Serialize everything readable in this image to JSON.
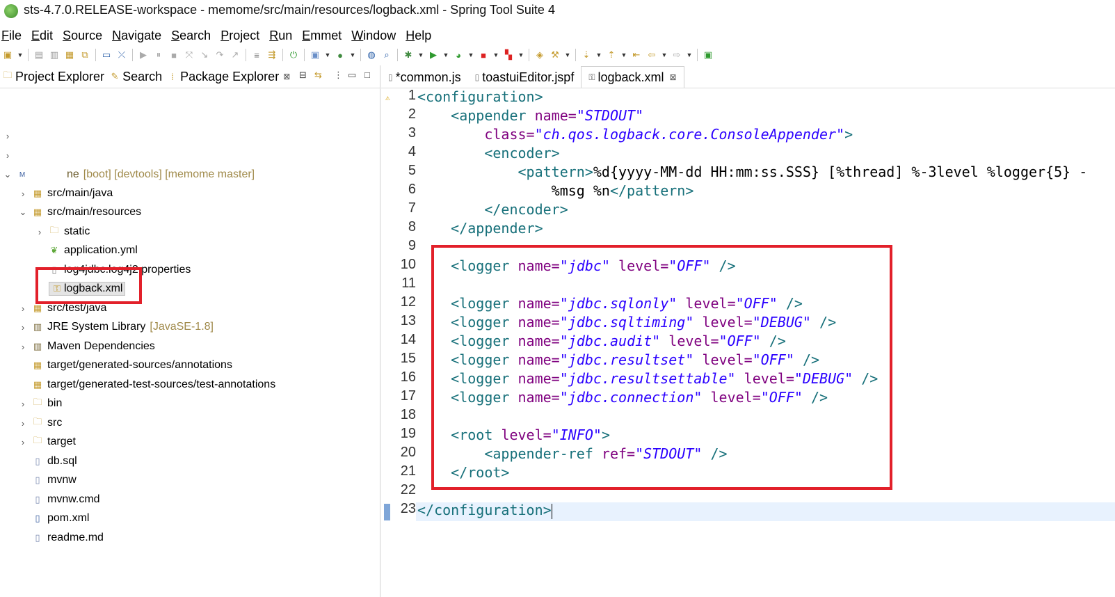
{
  "window": {
    "title": "sts-4.7.0.RELEASE-workspace - memome/src/main/resources/logback.xml - Spring Tool Suite 4"
  },
  "menubar": {
    "items": [
      {
        "u": "F",
        "rest": "ile"
      },
      {
        "u": "E",
        "rest": "dit"
      },
      {
        "u": "S",
        "rest": "ource"
      },
      {
        "u": "N",
        "rest": "avigate"
      },
      {
        "u": "S",
        "rest": "earch"
      },
      {
        "u": "P",
        "rest": "roject"
      },
      {
        "u": "R",
        "rest": "un"
      },
      {
        "u": "E",
        "rest": "mmet"
      },
      {
        "u": "W",
        "rest": "indow"
      },
      {
        "u": "H",
        "rest": "elp"
      }
    ]
  },
  "left_panel": {
    "tabs": [
      {
        "label": "Project Explorer",
        "icon": "project-explorer-icon"
      },
      {
        "label": "Search",
        "icon": "search-icon"
      },
      {
        "label": "Package Explorer",
        "icon": "package-explorer-icon",
        "close": "⊠"
      }
    ],
    "project": {
      "name": "ne",
      "decorations": "[boot] [devtools] [memome master]"
    },
    "tree": [
      {
        "label": "src/main/java"
      },
      {
        "label": "src/main/resources"
      },
      {
        "label": "static"
      },
      {
        "label": "application.yml"
      },
      {
        "label": "log4jdbc.log4j2.properties"
      },
      {
        "label": "logback.xml"
      },
      {
        "label": "src/test/java"
      },
      {
        "label": "JRE System Library",
        "extra": "[JavaSE-1.8]"
      },
      {
        "label": "Maven Dependencies"
      },
      {
        "label": "target/generated-sources/annotations"
      },
      {
        "label": "target/generated-test-sources/test-annotations"
      },
      {
        "label": "bin"
      },
      {
        "label": "src"
      },
      {
        "label": "target"
      },
      {
        "label": "db.sql"
      },
      {
        "label": "mvnw"
      },
      {
        "label": "mvnw.cmd"
      },
      {
        "label": "pom.xml"
      },
      {
        "label": "readme.md"
      }
    ]
  },
  "editor": {
    "tabs": [
      {
        "label": "*common.js"
      },
      {
        "label": "toastuiEditor.jspf"
      },
      {
        "label": "logback.xml",
        "close": "⊠"
      }
    ],
    "line_numbers": [
      "1",
      "2",
      "3",
      "4",
      "5",
      "6",
      "7",
      "8",
      "9",
      "10",
      "11",
      "12",
      "13",
      "14",
      "15",
      "16",
      "17",
      "18",
      "19",
      "20",
      "21",
      "22",
      "23"
    ],
    "code": {
      "l1": "<configuration>",
      "l2_tag": "<appender",
      "l2_attr": "name=",
      "l2_val": "\"STDOUT\"",
      "l3_attr": "class=",
      "l3_val": "\"ch.qos.logback.core.ConsoleAppender\"",
      "l3_end": ">",
      "l4": "<encoder>",
      "l5_open": "<pattern>",
      "l5_text": "%d{yyyy-MM-dd HH:mm:ss.SSS} [%thread] %-3level %logger{5} -",
      "l6_text": "%msg %n",
      "l6_close": "</pattern>",
      "l7": "</encoder>",
      "l8": "</appender>",
      "logger_tag": "<logger",
      "name_attr": "name=",
      "level_attr": "level=",
      "self_close": "/>",
      "l10_name": "\"jdbc\"",
      "l10_level": "\"OFF\"",
      "l12_name": "\"jdbc.sqlonly\"",
      "l12_level": "\"OFF\"",
      "l13_name": "\"jdbc.sqltiming\"",
      "l13_level": "\"DEBUG\"",
      "l14_name": "\"jdbc.audit\"",
      "l14_level": "\"OFF\"",
      "l15_name": "\"jdbc.resultset\"",
      "l15_level": "\"OFF\"",
      "l16_name": "\"jdbc.resultsettable\"",
      "l16_level": "\"DEBUG\"",
      "l17_name": "\"jdbc.connection\"",
      "l17_level": "\"OFF\"",
      "l19_tag": "<root",
      "l19_attr": "level=",
      "l19_val": "\"INFO\"",
      "l19_end": ">",
      "l20_tag": "<appender-ref",
      "l20_attr": "ref=",
      "l20_val": "\"STDOUT\"",
      "l21": "</root>",
      "l23": "</configuration>"
    }
  },
  "colors": {
    "tag": "#17707a",
    "attribute": "#7f007f",
    "value": "#2a00ff",
    "highlight_box": "#e2202a"
  }
}
